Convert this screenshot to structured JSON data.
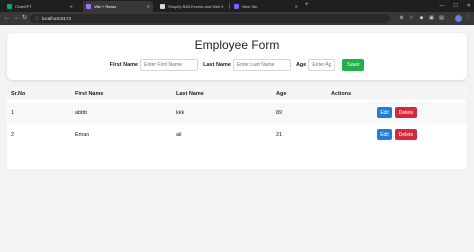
{
  "browser": {
    "tabs": [
      {
        "title": "ChatGPT",
        "icon_color": "#10a37f",
        "active": false
      },
      {
        "title": "Vite + React",
        "icon_color": "#a074f8",
        "active": true
      },
      {
        "title": "Shopify B2B Events and Web Cr...",
        "icon_color": "#d9d9d9",
        "active": false
      },
      {
        "title": "New Tab",
        "icon_color": "#7b61ff",
        "active": false
      }
    ],
    "url": "localhost:5173"
  },
  "form": {
    "title": "Employee Form",
    "first_name_label": "First Name",
    "first_name_placeholder": "Enter First Name",
    "last_name_label": "Last Name",
    "last_name_placeholder": "Enter Last Name",
    "age_label": "Age",
    "age_placeholder": "Enter Age",
    "save_label": "Save"
  },
  "table": {
    "headers": [
      "Sr.No",
      "First Name",
      "Last Name",
      "Age",
      "Actions"
    ],
    "rows": [
      {
        "srno": "1",
        "first": "abbb",
        "last": "kkk",
        "age": "89"
      },
      {
        "srno": "2",
        "first": "Eman",
        "last": "ali",
        "age": "21"
      }
    ],
    "edit_label": "Edit",
    "delete_label": "Delete"
  },
  "colors": {
    "save": "#22b04d",
    "edit": "#1e7ed8",
    "delete": "#d42a3e"
  }
}
